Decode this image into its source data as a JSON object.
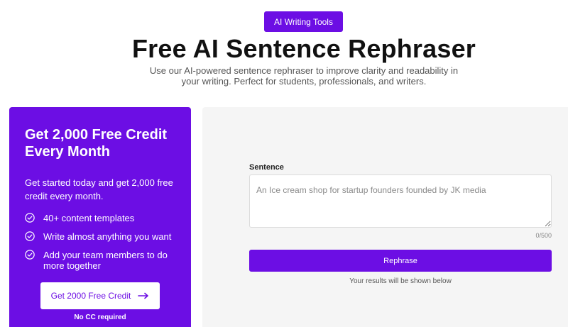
{
  "header": {
    "badge_label": "AI Writing Tools",
    "title": "Free AI Sentence Rephraser",
    "subtitle_line1": "Use our AI-powered sentence rephraser to improve clarity and readability in",
    "subtitle_line2": "your writing. Perfect for students, professionals, and writers."
  },
  "promo": {
    "title": "Get 2,000 Free Credit Every Month",
    "text": "Get started today and get 2,000 free credit every month.",
    "features": [
      "40+ content templates",
      "Write almost anything you want",
      "Add your team members to do more together"
    ],
    "button_label": "Get 2000 Free Credit",
    "note": "No CC required"
  },
  "form": {
    "label": "Sentence",
    "placeholder": "An Ice cream shop for startup founders founded by JK media",
    "value": "",
    "char_count": "0/500",
    "submit_label": "Rephrase",
    "results_note": "Your results will be shown below"
  },
  "colors": {
    "accent": "#6c0ee4",
    "panel_bg": "#f5f5f5"
  },
  "icons": {
    "feature": "check-circle-icon",
    "button": "arrow-right-icon"
  }
}
